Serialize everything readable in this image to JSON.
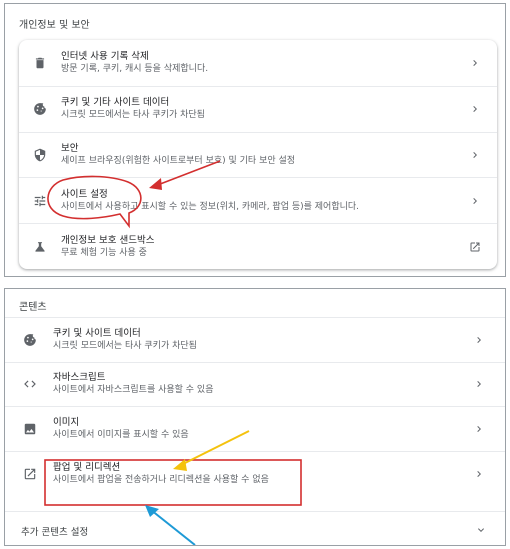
{
  "privacy": {
    "title": "개인정보 및 보안",
    "items": [
      {
        "icon": "trash-icon",
        "title": "인터넷 사용 기록 삭제",
        "subtitle": "방문 기록, 쿠키, 캐시 등을 삭제합니다.",
        "action": "chevron-right-icon"
      },
      {
        "icon": "cookie-icon",
        "title": "쿠키 및 기타 사이트 데이터",
        "subtitle": "시크릿 모드에서는 타사 쿠키가 차단됨",
        "action": "chevron-right-icon"
      },
      {
        "icon": "shield-icon",
        "title": "보안",
        "subtitle": "세이프 브라우징(위험한 사이트로부터 보호) 및 기타 보안 설정",
        "action": "chevron-right-icon"
      },
      {
        "icon": "tune-icon",
        "title": "사이트 설정",
        "subtitle": "사이트에서 사용하고 표시할 수 있는 정보(위치, 카메라, 팝업 등)를 제어합니다.",
        "action": "chevron-right-icon"
      },
      {
        "icon": "flask-icon",
        "title": "개인정보 보호 샌드박스",
        "subtitle": "무료 체험 기능 사용 중",
        "action": "open-in-new-icon"
      }
    ]
  },
  "content": {
    "title": "콘텐츠",
    "items": [
      {
        "icon": "cookie-icon",
        "title": "쿠키 및 사이트 데이터",
        "subtitle": "시크릿 모드에서는 타사 쿠키가 차단됨",
        "action": "chevron-right-icon"
      },
      {
        "icon": "code-icon",
        "title": "자바스크립트",
        "subtitle": "사이트에서 자바스크립트를 사용할 수 있음",
        "action": "chevron-right-icon"
      },
      {
        "icon": "image-icon",
        "title": "이미지",
        "subtitle": "사이트에서 이미지를 표시할 수 있음",
        "action": "chevron-right-icon"
      },
      {
        "icon": "open-in-new-icon",
        "title": "팝업 및 리디렉션",
        "subtitle": "사이트에서 팝업을 전송하거나 리디렉션을 사용할 수 없음",
        "action": "chevron-right-icon"
      }
    ],
    "more_label": "추가 콘텐츠 설정"
  },
  "annotation_colors": {
    "red": "#d32f2f",
    "yellow": "#f4c20d",
    "blue": "#1e9ad6"
  }
}
